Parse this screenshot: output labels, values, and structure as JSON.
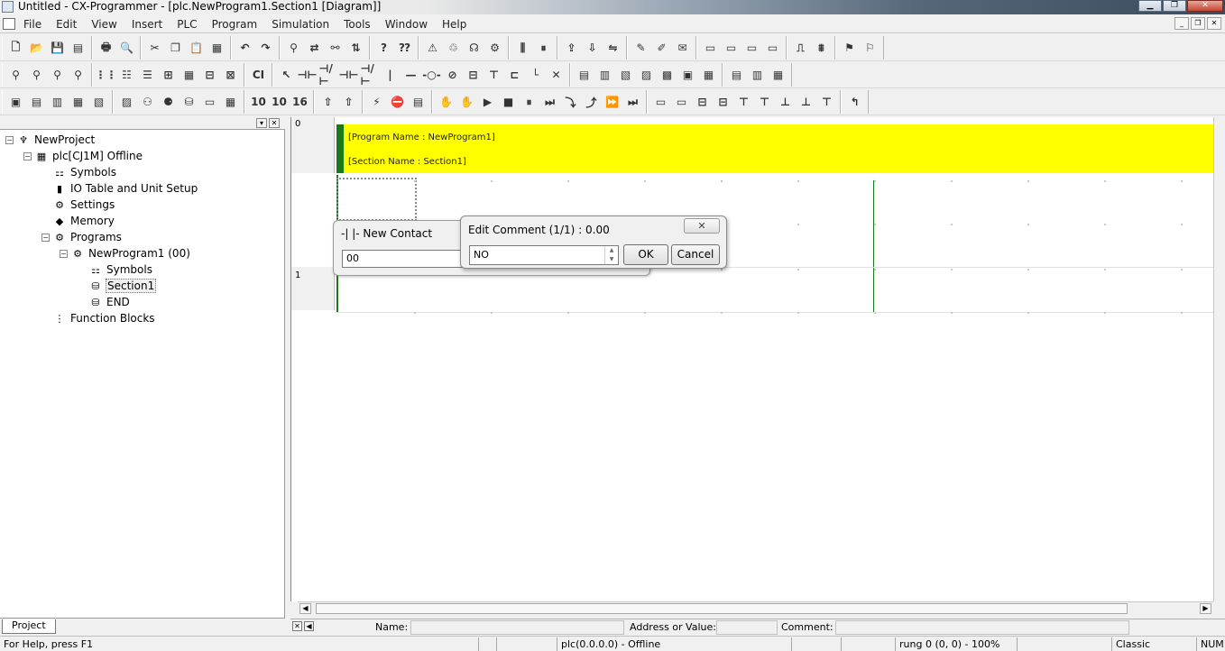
{
  "window": {
    "title": "Untitled - CX-Programmer - [plc.NewProgram1.Section1 [Diagram]]"
  },
  "menu": [
    "File",
    "Edit",
    "View",
    "Insert",
    "PLC",
    "Program",
    "Simulation",
    "Tools",
    "Window",
    "Help"
  ],
  "toolbars": {
    "row1": [
      {
        "name": "new-file-icon",
        "glyph": "🗋"
      },
      {
        "name": "open-folder-icon",
        "glyph": "📂"
      },
      {
        "name": "save-icon",
        "glyph": "💾"
      },
      {
        "name": "properties-icon",
        "glyph": "▤"
      },
      {
        "name": "print-icon",
        "glyph": "🖶"
      },
      {
        "name": "print-preview-icon",
        "glyph": "🔍"
      },
      {
        "name": "cut-icon",
        "glyph": "✂"
      },
      {
        "name": "copy-icon",
        "glyph": "❐"
      },
      {
        "name": "paste-icon",
        "glyph": "📋"
      },
      {
        "name": "paste-special-icon",
        "glyph": "▦"
      },
      {
        "name": "undo-icon",
        "glyph": "↶"
      },
      {
        "name": "redo-icon",
        "glyph": "↷"
      },
      {
        "name": "find-icon",
        "glyph": "⚲"
      },
      {
        "name": "replace-icon",
        "glyph": "⇄"
      },
      {
        "name": "cross-reference-icon",
        "glyph": "⚯"
      },
      {
        "name": "address-reference-icon",
        "glyph": "⇅"
      },
      {
        "name": "help-icon",
        "glyph": "?"
      },
      {
        "name": "context-help-icon",
        "glyph": "⁇"
      },
      {
        "name": "warning-icon",
        "glyph": "⚠"
      },
      {
        "name": "online-icon",
        "glyph": "♲"
      },
      {
        "name": "monitor-icon",
        "glyph": "☊"
      },
      {
        "name": "debug-icon",
        "glyph": "⚙"
      },
      {
        "name": "run-icon",
        "glyph": "⫼"
      },
      {
        "name": "pause-icon",
        "glyph": "⏸"
      },
      {
        "name": "transfer-to-plc-icon",
        "glyph": "⇪"
      },
      {
        "name": "transfer-from-plc-icon",
        "glyph": "⇩"
      },
      {
        "name": "compare-icon",
        "glyph": "⇋"
      },
      {
        "name": "online-edit-icon",
        "glyph": "✎"
      },
      {
        "name": "online-edit-cancel-icon",
        "glyph": "✐"
      },
      {
        "name": "online-edit-send-icon",
        "glyph": "✉"
      },
      {
        "name": "io-table-icon",
        "glyph": "▭"
      },
      {
        "name": "memory-icon",
        "glyph": "▭"
      },
      {
        "name": "setup-icon",
        "glyph": "▭"
      },
      {
        "name": "data-trace-icon",
        "glyph": "▭"
      },
      {
        "name": "time-chart-icon",
        "glyph": "⎍"
      },
      {
        "name": "waveform-icon",
        "glyph": "⩩"
      },
      {
        "name": "plc-info-icon",
        "glyph": "⚑"
      },
      {
        "name": "error-log-icon",
        "glyph": "⚐"
      }
    ],
    "row2": [
      {
        "name": "zoom-icon",
        "glyph": "⚲"
      },
      {
        "name": "zoom-in-icon",
        "glyph": "⚲"
      },
      {
        "name": "zoom-out-icon",
        "glyph": "⚲"
      },
      {
        "name": "zoom-fit-icon",
        "glyph": "⚲"
      },
      {
        "name": "grid-icon",
        "glyph": "⋮⋮"
      },
      {
        "name": "show-comments-icon",
        "glyph": "☷"
      },
      {
        "name": "rung-annotation-icon",
        "glyph": "☰"
      },
      {
        "name": "monitor-in-diagram-icon",
        "glyph": "⊞"
      },
      {
        "name": "program-view-icon",
        "glyph": "▦"
      },
      {
        "name": "watch-window-icon",
        "glyph": "⊟"
      },
      {
        "name": "symbol-table-icon",
        "glyph": "⊠"
      },
      {
        "name": "ci-icon",
        "glyph": "CI"
      },
      {
        "name": "select-mode-icon",
        "glyph": "↖"
      },
      {
        "name": "new-contact-icon",
        "glyph": "⊣⊢"
      },
      {
        "name": "new-closed-contact-icon",
        "glyph": "⊣/⊢"
      },
      {
        "name": "new-or-contact-icon",
        "glyph": "⊣⊢"
      },
      {
        "name": "new-or-closed-contact-icon",
        "glyph": "⊣/⊢"
      },
      {
        "name": "vertical-line-icon",
        "glyph": "|"
      },
      {
        "name": "horizontal-line-icon",
        "glyph": "—"
      },
      {
        "name": "new-coil-icon",
        "glyph": "-○-"
      },
      {
        "name": "new-closed-coil-icon",
        "glyph": "⊘"
      },
      {
        "name": "new-instruction-icon",
        "glyph": "⊟"
      },
      {
        "name": "new-pt-icon",
        "glyph": "⊤"
      },
      {
        "name": "new-fb-icon",
        "glyph": "⊏"
      },
      {
        "name": "line-connect-icon",
        "glyph": "└"
      },
      {
        "name": "delete-line-icon",
        "glyph": "✕"
      },
      {
        "name": "rung-icon",
        "glyph": "▤"
      },
      {
        "name": "mnemonic-icon",
        "glyph": "▥"
      },
      {
        "name": "local-symbol-icon",
        "glyph": "▧"
      },
      {
        "name": "global-symbol-icon",
        "glyph": "▨"
      },
      {
        "name": "fb-instance-icon",
        "glyph": "▩"
      },
      {
        "name": "st-icon",
        "glyph": "▣"
      },
      {
        "name": "sfc-icon",
        "glyph": "▦"
      },
      {
        "name": "ladder-icon",
        "glyph": "▤"
      },
      {
        "name": "list-icon",
        "glyph": "▥"
      },
      {
        "name": "table-icon",
        "glyph": "▦"
      }
    ],
    "row3": [
      {
        "name": "view-project-icon",
        "glyph": "▣"
      },
      {
        "name": "view-output-icon",
        "glyph": "▤"
      },
      {
        "name": "view-watch-icon",
        "glyph": "▥"
      },
      {
        "name": "view-address-icon",
        "glyph": "▦"
      },
      {
        "name": "view-properties-icon",
        "glyph": "▧"
      },
      {
        "name": "view-cross-ref-icon",
        "glyph": "▨"
      },
      {
        "name": "view-ladder-icon",
        "glyph": "⚇"
      },
      {
        "name": "view-mnemonic-icon",
        "glyph": "⚈"
      },
      {
        "name": "view-st-icon",
        "glyph": "⛁"
      },
      {
        "name": "view-local-icon",
        "glyph": "▭"
      },
      {
        "name": "view-global-icon",
        "glyph": "▦"
      },
      {
        "name": "display-dec-icon",
        "glyph": "10"
      },
      {
        "name": "display-bin-icon",
        "glyph": "10"
      },
      {
        "name": "display-hex-icon",
        "glyph": "16"
      },
      {
        "name": "compile-icon",
        "glyph": "⇧"
      },
      {
        "name": "compile-all-icon",
        "glyph": "⇧"
      },
      {
        "name": "work-online-icon",
        "glyph": "⚡"
      },
      {
        "name": "work-offline-icon",
        "glyph": "⛔"
      },
      {
        "name": "online-simulator-icon",
        "glyph": "▤"
      },
      {
        "name": "sim-step-icon",
        "glyph": "✋"
      },
      {
        "name": "sim-step-into-icon",
        "glyph": "✋"
      },
      {
        "name": "sim-run-icon",
        "glyph": "▶"
      },
      {
        "name": "sim-stop-icon",
        "glyph": "■"
      },
      {
        "name": "sim-pause-icon",
        "glyph": "⏸"
      },
      {
        "name": "sim-step-run-icon",
        "glyph": "⏭"
      },
      {
        "name": "sim-step-out-icon",
        "glyph": "⤵"
      },
      {
        "name": "sim-scan-icon",
        "glyph": "⤴"
      },
      {
        "name": "sim-continuous-icon",
        "glyph": "⏩"
      },
      {
        "name": "sim-end-icon",
        "glyph": "⏭"
      },
      {
        "name": "fill-rung-icon",
        "glyph": "▭"
      },
      {
        "name": "insert-rung-icon",
        "glyph": "▭"
      },
      {
        "name": "insert-row-icon",
        "glyph": "⊟"
      },
      {
        "name": "insert-column-icon",
        "glyph": "⊟"
      },
      {
        "name": "delete-row-icon",
        "glyph": "⊤"
      },
      {
        "name": "delete-column-icon",
        "glyph": "⊤"
      },
      {
        "name": "insert-element-icon",
        "glyph": "⊥"
      },
      {
        "name": "delete-element-icon",
        "glyph": "⊥"
      },
      {
        "name": "join-icon",
        "glyph": "⊤"
      },
      {
        "name": "return-icon",
        "glyph": "↰"
      }
    ]
  },
  "project_tree": {
    "items": [
      {
        "label": "NewProject",
        "icon": "project-icon",
        "glyph": "♆",
        "level": 0,
        "expander": "−"
      },
      {
        "label": "plc[CJ1M] Offline",
        "icon": "plc-icon",
        "glyph": "▦",
        "level": 1,
        "expander": "−"
      },
      {
        "label": "Symbols",
        "icon": "symbols-icon",
        "glyph": "⚏",
        "level": 2,
        "expander": ""
      },
      {
        "label": "IO Table and Unit Setup",
        "icon": "io-table-icon",
        "glyph": "▮",
        "level": 2,
        "expander": ""
      },
      {
        "label": "Settings",
        "icon": "settings-icon",
        "glyph": "⚙",
        "level": 2,
        "expander": ""
      },
      {
        "label": "Memory",
        "icon": "memory-icon",
        "glyph": "◆",
        "level": 2,
        "expander": ""
      },
      {
        "label": "Programs",
        "icon": "programs-icon",
        "glyph": "⚙",
        "level": 2,
        "expander": "−"
      },
      {
        "label": "NewProgram1 (00)",
        "icon": "program-icon",
        "glyph": "⚙",
        "level": 3,
        "expander": "−"
      },
      {
        "label": "Symbols",
        "icon": "symbols-icon",
        "glyph": "⚏",
        "level": 4,
        "expander": ""
      },
      {
        "label": "Section1",
        "icon": "section-icon",
        "glyph": "⛁",
        "level": 4,
        "expander": "",
        "selected": true
      },
      {
        "label": "END",
        "icon": "section-end-icon",
        "glyph": "⛁",
        "level": 4,
        "expander": ""
      },
      {
        "label": "Function Blocks",
        "icon": "function-blocks-icon",
        "glyph": "⋮",
        "level": 2,
        "expander": ""
      }
    ],
    "tab_label": "Project"
  },
  "diagram": {
    "rungs": [
      "0",
      "1"
    ],
    "program_name_line": "[Program Name : NewProgram1]",
    "section_name_line": "[Section Name : Section1]",
    "colors": {
      "header_bg": "#ffff00",
      "rail": "#1a7a1a"
    }
  },
  "new_contact_dialog": {
    "title": "-| |- New Contact",
    "value": "00"
  },
  "edit_comment_dialog": {
    "title": "Edit Comment (1/1) : 0.00",
    "value": "NO",
    "ok_label": "OK",
    "cancel_label": "Cancel",
    "close_label": "✕"
  },
  "properties_bar": {
    "name_label": "Name:",
    "address_label": "Address or Value:",
    "comment_label": "Comment:"
  },
  "status_bar": {
    "help": "For Help, press F1",
    "connection": "plc(0.0.0.0) - Offline",
    "position": "rung 0 (0, 0)  - 100%",
    "theme": "Classic",
    "num": "NUM"
  }
}
